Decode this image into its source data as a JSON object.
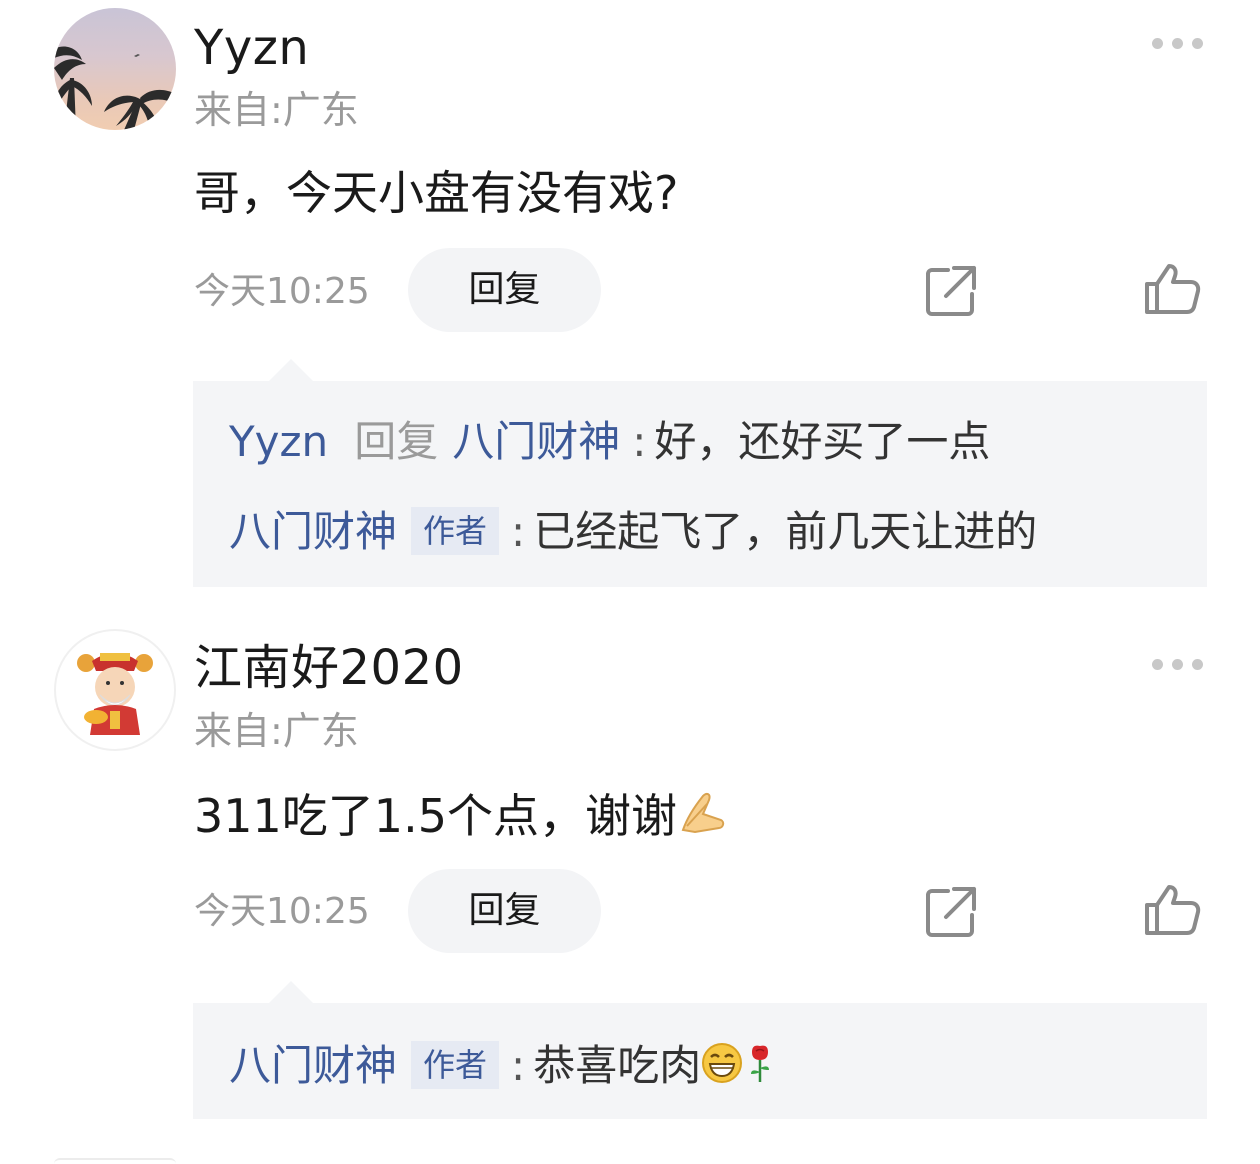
{
  "comments": [
    {
      "username": "Yyzn",
      "location": "来自:广东",
      "text": "哥，今天小盘有没有戏?",
      "time": "今天10:25",
      "reply_label": "回复",
      "thread": [
        {
          "from": "Yyzn",
          "reply_word": "回复",
          "to": "八门财神",
          "text": "好，还好买了一点"
        },
        {
          "from": "八门财神",
          "badge": "作者",
          "text": "已经起飞了，前几天让进的"
        }
      ]
    },
    {
      "username": "江南好2020",
      "location": "来自:广东",
      "text": "311吃了1.5个点，谢谢",
      "text_emoji": "pray-hands-emoji",
      "time": "今天10:25",
      "reply_label": "回复",
      "thread": [
        {
          "from": "八门财神",
          "badge": "作者",
          "text": "恭喜吃肉",
          "emojis": [
            "grin-emoji",
            "rose-emoji"
          ]
        }
      ]
    }
  ],
  "colors": {
    "accent_name": "#3d5a99",
    "muted": "#9a9a9a",
    "thread_bg": "#f4f5f7"
  }
}
